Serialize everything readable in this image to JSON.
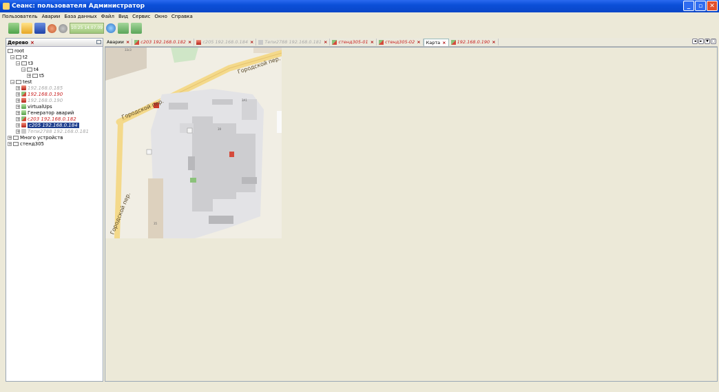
{
  "window": {
    "title": "Сеанс: пользователя Администратор"
  },
  "menu": [
    "Пользователь",
    "Аварии",
    "База данных",
    "Файл",
    "Вид",
    "Сервис",
    "Окно",
    "Справка"
  ],
  "toolbar": {
    "time_widget": "10:25 14.07.09"
  },
  "left_panel": {
    "tab_label": "Дерево",
    "tab_close": "×"
  },
  "tree": [
    {
      "label": "root",
      "expander": "",
      "icon": "folder",
      "style": "normal"
    },
    {
      "label": "t2",
      "expander": "−",
      "icon": "folder",
      "style": "normal"
    },
    {
      "label": "t3",
      "expander": "−",
      "icon": "folder",
      "style": "normal"
    },
    {
      "label": "t4",
      "expander": "−",
      "icon": "folder",
      "style": "normal"
    },
    {
      "label": "t5",
      "expander": "+",
      "icon": "folder",
      "style": "normal"
    },
    {
      "label": "test",
      "expander": "−",
      "icon": "folder",
      "style": "normal"
    },
    {
      "label": "192.168.0.185",
      "expander": "+",
      "icon": "red",
      "style": "gray"
    },
    {
      "label": "192.168.0.190",
      "expander": "+",
      "icon": "pair",
      "style": "red"
    },
    {
      "label": "192.168.0.190",
      "expander": "+",
      "icon": "red",
      "style": "gray"
    },
    {
      "label": "virtualUps",
      "expander": "+",
      "icon": "green",
      "style": "normal"
    },
    {
      "label": "Генератор аварий",
      "expander": "+",
      "icon": "green",
      "style": "normal"
    },
    {
      "label": "c203 192.168.0.182",
      "expander": "+",
      "icon": "pair",
      "style": "red"
    },
    {
      "label": "c205 192.168.0.184",
      "expander": "+",
      "icon": "red",
      "style": "selected"
    },
    {
      "label": "Тепи2788 192.168.0.181",
      "expander": "+",
      "icon": "gray",
      "style": "gray"
    },
    {
      "label": "Много устройств",
      "expander": "+",
      "icon": "folder",
      "style": "normal"
    },
    {
      "label": "стенд305",
      "expander": "+",
      "icon": "folder",
      "style": "normal"
    }
  ],
  "tabs": [
    {
      "label": "Аварии",
      "icon": "",
      "style": "normal"
    },
    {
      "label": "c203 192.168.0.182",
      "icon": "pair",
      "style": "red"
    },
    {
      "label": "c205 192.168.0.184",
      "icon": "red",
      "style": "gray"
    },
    {
      "label": "Тепи2788 192.168.0.181",
      "icon": "gray",
      "style": "gray"
    },
    {
      "label": "стенд305-01",
      "icon": "pair",
      "style": "red"
    },
    {
      "label": "стенд305-02",
      "icon": "pair",
      "style": "red"
    },
    {
      "label": "Карта",
      "icon": "",
      "style": "active"
    },
    {
      "label": "192.168.0.190",
      "icon": "pair",
      "style": "red"
    }
  ],
  "tab_close": "×",
  "tab_nav": [
    "◄",
    "►",
    "▼",
    "□"
  ],
  "map": {
    "street_labels": [
      "Городской пер.",
      "Городской пер.",
      "Городской пер."
    ],
    "house_numbers": [
      "33с3",
      "3А1",
      "39",
      "35"
    ]
  },
  "colors": {
    "title_bar": "#0b4fd8",
    "selection": "#1f3f8f",
    "alarm_text": "#c91f1f"
  }
}
